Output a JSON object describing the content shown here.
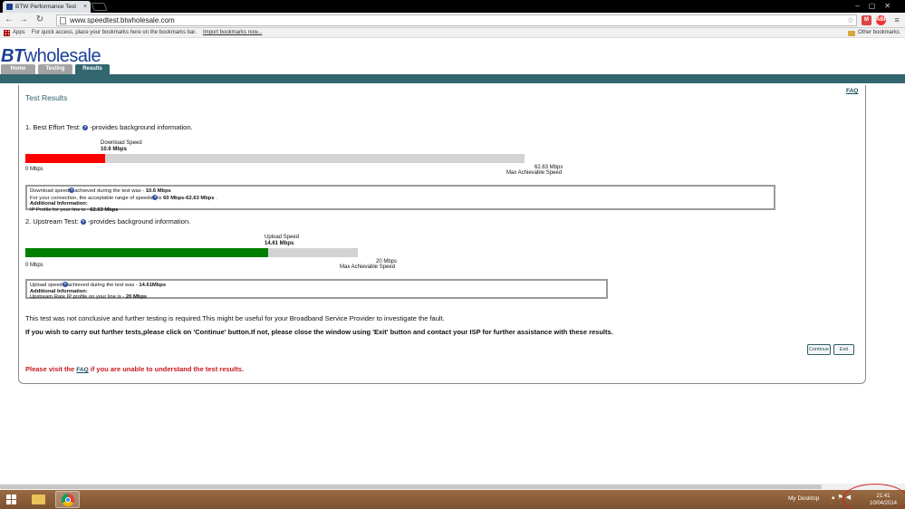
{
  "browser": {
    "tab_title": "BTW Performance Test",
    "url": "www.speedtest.btwholesale.com",
    "apps_label": "Apps",
    "bookmarks_hint": "For quick access, place your bookmarks here on the bookmarks bar.",
    "import_link": "Import bookmarks now...",
    "other_bookmarks": "Other bookmarks"
  },
  "site": {
    "logo_bold": "BT",
    "logo_rest": "wholesale",
    "tabs": [
      "Home",
      "Testing",
      "Results"
    ],
    "faq_link": "FAQ"
  },
  "results": {
    "title": "Test Results",
    "best_effort": {
      "heading_prefix": "1. Best Effort Test:",
      "heading_suffix": "-provides background information.",
      "speed_label": "Download Speed",
      "speed_value": "10.6 Mbps",
      "min_label": "0 Mbps",
      "max_value": "62.63 Mbps",
      "max_label": "Max Achievable Speed",
      "fill_fraction": 0.16,
      "fill_color": "#ff0000",
      "line1_prefix": "Download speed",
      "line1_mid": "achieved during the test was -",
      "line1_value": "10.6 Mbps",
      "line2_prefix": "For your connection, the acceptable range of speeds",
      "line2_mid": "is",
      "line2_value": "60 Mbps-62.63 Mbps",
      "line2_suffix": ".",
      "additional_label": "Additional Information:",
      "line3_prefix": "IP Profile for your line is -",
      "line3_value": "62.63 Mbps"
    },
    "upstream": {
      "heading_prefix": "2. Upstream Test:",
      "heading_suffix": "-provides background information.",
      "speed_label": "Upload Speed",
      "speed_value": "14.61 Mbps",
      "min_label": "0 Mbps",
      "max_value": "20 Mbps",
      "max_label": "Max Achievable Speed",
      "fill_fraction": 0.7305,
      "fill_color": "#007f00",
      "line1_prefix": "Upload speed",
      "line1_mid": "achieved during the test was -",
      "line1_value": "14.61Mbps",
      "additional_label": "Additional Information:",
      "line3_prefix": "Upstream Rate IP profile on your line is -",
      "line3_value": "20 Mbps"
    },
    "verdict": "This test was not conclusive and further testing is required.This might be useful for your Broadband Service Provider to investigate the fault.",
    "instructions": "If you wish to carry out further tests,please click on 'Continue' button.If not, please close the window using 'Exit' button and contact your ISP for further assistance with these results.",
    "continue_label": "Continue",
    "exit_label": "Exit",
    "visit_prefix": "Please visit the",
    "visit_link": "FAQ",
    "visit_suffix": "if you are unable to understand the test results."
  },
  "taskbar": {
    "desktop_label": "My Desktop",
    "time": "21:41",
    "date": "10/04/2014"
  },
  "icons": [
    "back-icon",
    "forward-icon",
    "reload-icon",
    "star-icon",
    "question-icon",
    "windows-logo-icon",
    "explorer-icon",
    "chrome-icon"
  ]
}
